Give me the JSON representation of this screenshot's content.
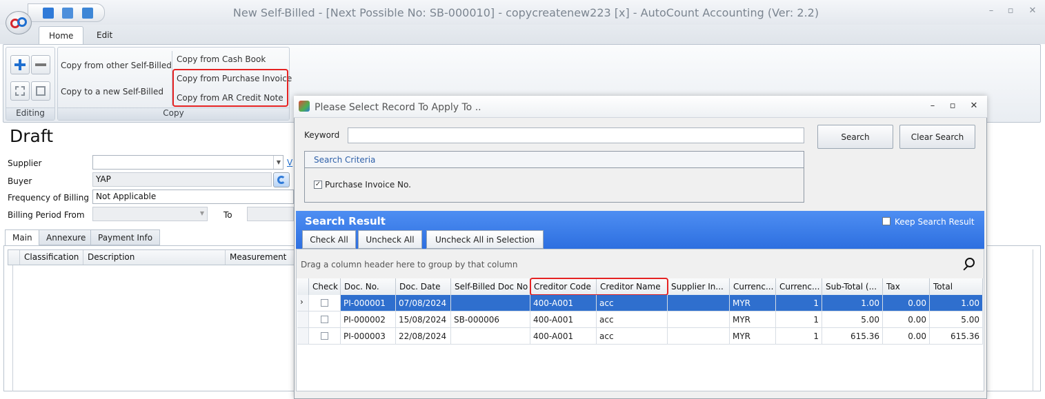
{
  "window": {
    "title": "New Self-Billed - [Next Possible No: SB-000010] - copycreatenew223 [x] - AutoCount Accounting (Ver: 2.2)",
    "minimize": "–",
    "maximize": "▫",
    "close": "✕"
  },
  "ribbon": {
    "tabs": [
      "Home",
      "Edit"
    ],
    "editing_label": "Editing",
    "copy_label": "Copy",
    "copy_from_other": "Copy from other Self-Billed",
    "copy_to_new": "Copy to a new Self-Billed",
    "copy_from_cash_book": "Copy from Cash Book",
    "copy_from_purchase_invoice": "Copy from Purchase Invoice",
    "copy_from_ar_credit_note": "Copy from AR Credit Note"
  },
  "form": {
    "status": "Draft",
    "supplier_label": "Supplier",
    "supplier_value": "",
    "supplier_link": "V",
    "buyer_label": "Buyer",
    "buyer_value": "YAP",
    "frequency_label": "Frequency of Billing",
    "frequency_value": "Not Applicable",
    "billing_period_label": "Billing Period From",
    "to_label": "To",
    "tabs": [
      "Main",
      "Annexure",
      "Payment Info"
    ],
    "grid_columns": [
      "Classification",
      "Description",
      "Measurement"
    ]
  },
  "dialog": {
    "title": "Please Select Record To Apply To ..",
    "keyword_label": "Keyword",
    "keyword_value": "",
    "search_button": "Search",
    "clear_search_button": "Clear Search",
    "search_criteria_label": "Search Criteria",
    "criteria_option": "Purchase Invoice No.",
    "search_result_label": "Search Result",
    "keep_search_result": "Keep Search Result",
    "check_all": "Check All",
    "uncheck_all": "Uncheck All",
    "uncheck_all_selection": "Uncheck All in Selection",
    "group_hint": "Drag a column header here to group by that column",
    "columns": [
      "Check",
      "Doc. No.",
      "Doc. Date",
      "Self-Billed Doc No",
      "Creditor Code",
      "Creditor Name",
      "Supplier In...",
      "Currenc...",
      "Currenc...",
      "Sub-Total (...",
      "Tax",
      "Total"
    ],
    "rows": [
      {
        "doc_no": "PI-000001",
        "doc_date": "07/08/2024",
        "sb_doc": "",
        "creditor_code": "400-A001",
        "creditor_name": "acc",
        "supplier_inv": "",
        "currency": "MYR",
        "rate": "1",
        "subtotal": "1.00",
        "tax": "0.00",
        "total": "1.00",
        "selected": true
      },
      {
        "doc_no": "PI-000002",
        "doc_date": "15/08/2024",
        "sb_doc": "SB-000006",
        "creditor_code": "400-A001",
        "creditor_name": "acc",
        "supplier_inv": "",
        "currency": "MYR",
        "rate": "1",
        "subtotal": "5.00",
        "tax": "0.00",
        "total": "5.00",
        "selected": false
      },
      {
        "doc_no": "PI-000003",
        "doc_date": "22/08/2024",
        "sb_doc": "",
        "creditor_code": "400-A001",
        "creditor_name": "acc",
        "supplier_inv": "",
        "currency": "MYR",
        "rate": "1",
        "subtotal": "615.36",
        "tax": "0.00",
        "total": "615.36",
        "selected": false
      }
    ]
  },
  "colors": {
    "accent": "#2d6fe0",
    "selected_row": "#2f6fce",
    "highlight": "#e52222"
  }
}
